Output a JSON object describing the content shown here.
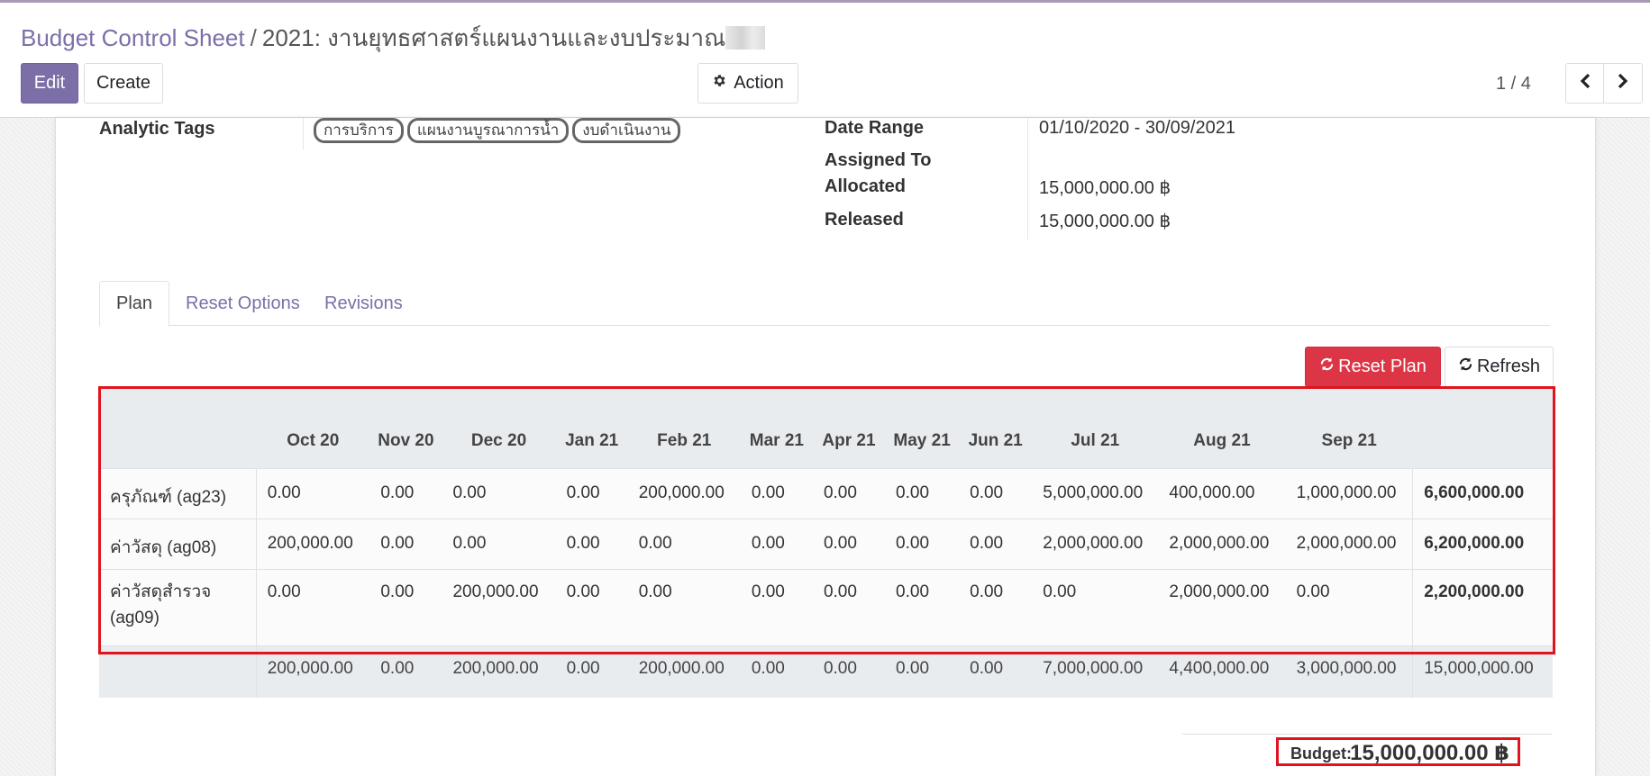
{
  "breadcrumb": {
    "parent": "Budget Control Sheet",
    "separator": "/",
    "current": "2021: งานยุทธศาสตร์แผนงานและงบประมาณ"
  },
  "toolbar": {
    "edit_label": "Edit",
    "create_label": "Create",
    "action_label": "Action",
    "pager_value": "1 / 4"
  },
  "form": {
    "analytic_tags_label": "Analytic Tags",
    "analytic_tags": [
      "การบริการ",
      "แผนงานบูรณาการน้ำ",
      "งบดำเนินงาน"
    ],
    "date_range_label": "Date Range",
    "date_range_value": "01/10/2020 - 30/09/2021",
    "assigned_to_label": "Assigned To",
    "assigned_to_value": "",
    "allocated_label": "Allocated",
    "allocated_value": "15,000,000.00 ฿",
    "released_label": "Released",
    "released_value": "15,000,000.00 ฿"
  },
  "tabs": [
    {
      "label": "Plan",
      "active": true
    },
    {
      "label": "Reset Options",
      "active": false
    },
    {
      "label": "Revisions",
      "active": false
    }
  ],
  "plan_buttons": {
    "reset_label": "Reset Plan",
    "refresh_label": "Refresh"
  },
  "plan_table": {
    "columns": [
      "Oct 20",
      "Nov 20",
      "Dec 20",
      "Jan 21",
      "Feb 21",
      "Mar 21",
      "Apr 21",
      "May 21",
      "Jun 21",
      "Jul 21",
      "Aug 21",
      "Sep 21"
    ],
    "rows": [
      {
        "name": "ครุภัณฑ์ (ag23)",
        "values": [
          "0.00",
          "0.00",
          "0.00",
          "0.00",
          "200,000.00",
          "0.00",
          "0.00",
          "0.00",
          "0.00",
          "5,000,000.00",
          "400,000.00",
          "1,000,000.00"
        ],
        "total": "6,600,000.00"
      },
      {
        "name": "ค่าวัสดุ (ag08)",
        "values": [
          "200,000.00",
          "0.00",
          "0.00",
          "0.00",
          "0.00",
          "0.00",
          "0.00",
          "0.00",
          "0.00",
          "2,000,000.00",
          "2,000,000.00",
          "2,000,000.00"
        ],
        "total": "6,200,000.00"
      },
      {
        "name": "ค่าวัสดุสำรวจ (ag09)",
        "values": [
          "0.00",
          "0.00",
          "200,000.00",
          "0.00",
          "0.00",
          "0.00",
          "0.00",
          "0.00",
          "0.00",
          "0.00",
          "2,000,000.00",
          "0.00"
        ],
        "total": "2,200,000.00"
      }
    ],
    "totals": [
      "200,000.00",
      "0.00",
      "200,000.00",
      "0.00",
      "200,000.00",
      "0.00",
      "0.00",
      "0.00",
      "0.00",
      "7,000,000.00",
      "4,400,000.00",
      "3,000,000.00"
    ],
    "grand_total": "15,000,000.00"
  },
  "budget": {
    "label": "Budget:",
    "value": "15,000,000.00 ฿"
  },
  "colors": {
    "brand": "#7c6fa8",
    "danger": "#dc3545",
    "highlight": "#e0141e"
  }
}
